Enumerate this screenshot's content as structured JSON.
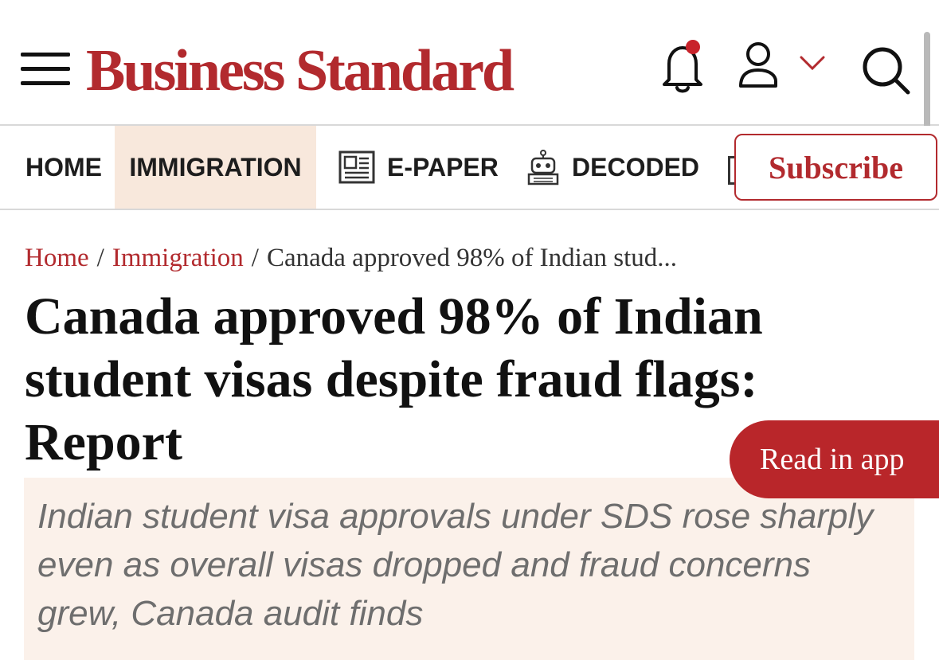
{
  "colors": {
    "brand_red": "#b22a2e",
    "nav_active_bg": "#f8e8dc",
    "summary_bg": "#fbf1ea",
    "read_app_bg": "#b9262a",
    "notification_dot": "#c8232b"
  },
  "header": {
    "menu_icon": "hamburger-menu-icon",
    "logo_text": "Business Standard",
    "icons": [
      "bell-icon",
      "user-icon",
      "chevron-down-icon",
      "search-icon"
    ]
  },
  "nav": {
    "items": [
      {
        "label": "HOME"
      },
      {
        "label": "IMMIGRATION",
        "active": true
      },
      {
        "label": "E-PAPER",
        "icon": "newspaper-icon"
      },
      {
        "label": "DECODED",
        "icon": "robot-icon"
      }
    ],
    "subscribe_label": "Subscribe"
  },
  "breadcrumb": {
    "home": "Home",
    "separator": "/",
    "section": "Immigration",
    "current": "Canada approved 98% of Indian stud..."
  },
  "article": {
    "headline": "Canada approved 98% of Indian student visas despite fraud flags: Report",
    "summary": "Indian student visa approvals under SDS rose sharply even as overall visas dropped and fraud concerns grew, Canada audit finds"
  },
  "read_in_app_label": "Read in app"
}
